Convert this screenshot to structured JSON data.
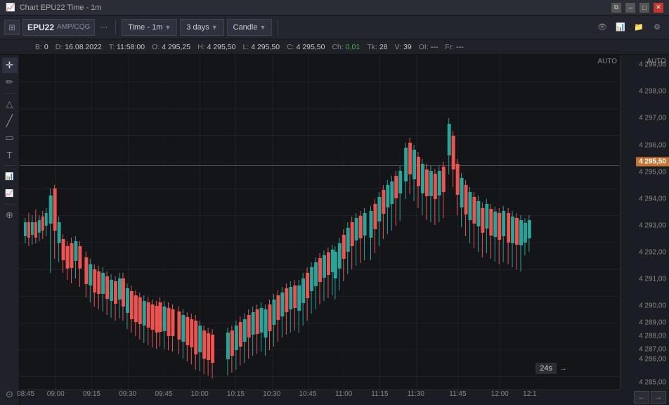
{
  "titlebar": {
    "title": "Chart EPU22 Time - 1m",
    "win_buttons": [
      "restore",
      "minimize",
      "maximize",
      "close"
    ]
  },
  "toolbar": {
    "symbol": "EPU22",
    "exchange": "AMP/CQG",
    "time_label": "Time - 1m",
    "period_label": "3 days",
    "chart_type": "Candle",
    "dots_label": "⋯"
  },
  "toolbar_icons": {
    "icon1": "⊞",
    "icon2": "≡",
    "icon3": "⚙",
    "icon4": "↗",
    "icon5": "⊕",
    "icon6": "↺"
  },
  "infobar": {
    "b_label": "B:",
    "b_value": "0",
    "d_label": "D:",
    "d_value": "16.08.2022",
    "t_label": "T:",
    "t_value": "11:58:00",
    "o_label": "O:",
    "o_value": "4 295,25",
    "h_label": "H:",
    "h_value": "4 295,50",
    "l_label": "L:",
    "l_value": "4 295,50",
    "c_label": "C:",
    "c_value": "4 295,50",
    "ch_label": "Ch:",
    "ch_value": "0,01",
    "tk_label": "Tk:",
    "tk_value": "28",
    "v_label": "V:",
    "v_value": "39",
    "oi_label": "OI:",
    "oi_value": "---",
    "fr_label": "Fr:",
    "fr_value": "---"
  },
  "price_axis": {
    "current_price": "4 295,50",
    "prices": [
      {
        "value": "4 299,00",
        "pct": 3
      },
      {
        "value": "4 298,00",
        "pct": 11
      },
      {
        "value": "4 297,00",
        "pct": 19
      },
      {
        "value": "4 296,00",
        "pct": 27
      },
      {
        "value": "4 295,00",
        "pct": 35
      },
      {
        "value": "4 294,00",
        "pct": 43
      },
      {
        "value": "4 293,00",
        "pct": 51
      },
      {
        "value": "4 292,00",
        "pct": 59
      },
      {
        "value": "4 291,00",
        "pct": 67
      },
      {
        "value": "4 290,00",
        "pct": 75
      },
      {
        "value": "4 289,00",
        "pct": 83
      },
      {
        "value": "4 288,00",
        "pct": 83.5
      },
      {
        "value": "4 287,00",
        "pct": 84
      },
      {
        "value": "4 286,00",
        "pct": 91
      },
      {
        "value": "4 285,00",
        "pct": 98
      }
    ]
  },
  "time_axis": {
    "labels": [
      {
        "time": "08:45",
        "pct": 1
      },
      {
        "time": "09:00",
        "pct": 6
      },
      {
        "time": "09:15",
        "pct": 12
      },
      {
        "time": "09:30",
        "pct": 18
      },
      {
        "time": "09:45",
        "pct": 24
      },
      {
        "time": "10:00",
        "pct": 30
      },
      {
        "time": "10:15",
        "pct": 36
      },
      {
        "time": "10:30",
        "pct": 42
      },
      {
        "time": "10:45",
        "pct": 48
      },
      {
        "time": "11:00",
        "pct": 54
      },
      {
        "time": "11:15",
        "pct": 60
      },
      {
        "time": "11:30",
        "pct": 66
      },
      {
        "time": "11:45",
        "pct": 73
      },
      {
        "time": "12:00",
        "pct": 80
      },
      {
        "time": "12:1",
        "pct": 85
      }
    ]
  },
  "countdown": "24s",
  "left_toolbar": {
    "buttons": [
      {
        "icon": "⊞",
        "name": "cursor-tool"
      },
      {
        "icon": "✏",
        "name": "draw-tool"
      },
      {
        "icon": "△",
        "name": "triangle-tool"
      },
      {
        "icon": "╱",
        "name": "line-tool"
      },
      {
        "icon": "⊟",
        "name": "rect-tool"
      },
      {
        "icon": "T",
        "name": "text-tool"
      },
      {
        "icon": "≡",
        "name": "indicators"
      },
      {
        "icon": "🔢",
        "name": "stats"
      },
      {
        "icon": "⊕",
        "name": "zoom-tool"
      },
      {
        "icon": "⊙",
        "name": "settings"
      }
    ]
  },
  "colors": {
    "green_candle": "#26a69a",
    "red_candle": "#ef5350",
    "bg": "#131519",
    "price_highlight": "#c87533",
    "crosshair": "rgba(200,200,200,0.3)"
  }
}
